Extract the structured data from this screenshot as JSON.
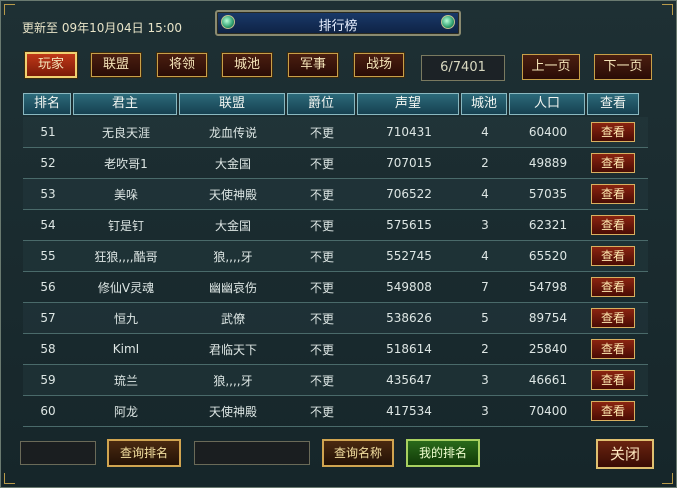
{
  "header": {
    "updated": "更新至 09年10月04日 15:00",
    "title": "排行榜"
  },
  "tabs": [
    "玩家",
    "联盟",
    "将领",
    "城池",
    "军事",
    "战场"
  ],
  "pagination": {
    "page_text": "6/7401",
    "prev": "上一页",
    "next": "下一页"
  },
  "table": {
    "columns": [
      "排名",
      "君主",
      "联盟",
      "爵位",
      "声望",
      "城池",
      "人口",
      "查看"
    ],
    "rows": [
      [
        "51",
        "无良天涯",
        "龙血传说",
        "不更",
        "710431",
        "4",
        "60400",
        "查看"
      ],
      [
        "52",
        "老吹哥1",
        "大金国",
        "不更",
        "707015",
        "2",
        "49889",
        "查看"
      ],
      [
        "53",
        "美哚",
        "天使神殿",
        "不更",
        "706522",
        "4",
        "57035",
        "查看"
      ],
      [
        "54",
        "钉是钉",
        "大金国",
        "不更",
        "575615",
        "3",
        "62321",
        "查看"
      ],
      [
        "55",
        "狂狼,,,,酷哥",
        "狼,,,,牙",
        "不更",
        "552745",
        "4",
        "65520",
        "查看"
      ],
      [
        "56",
        "修仙V灵魂",
        "幽幽哀伤",
        "不更",
        "549808",
        "7",
        "54798",
        "查看"
      ],
      [
        "57",
        "恒九",
        "武僚",
        "不更",
        "538626",
        "5",
        "89754",
        "查看"
      ],
      [
        "58",
        "KimI",
        "君临天下",
        "不更",
        "518614",
        "2",
        "25840",
        "查看"
      ],
      [
        "59",
        "琉兰",
        "狼,,,,牙",
        "不更",
        "435647",
        "3",
        "46661",
        "查看"
      ],
      [
        "60",
        "阿龙",
        "天使神殿",
        "不更",
        "417534",
        "3",
        "70400",
        "查看"
      ]
    ]
  },
  "footer": {
    "rank_input_value": "",
    "query_rank": "查询排名",
    "name_input_value": "",
    "query_name": "查询名称",
    "my_rank": "我的排名",
    "close": "关闭"
  }
}
